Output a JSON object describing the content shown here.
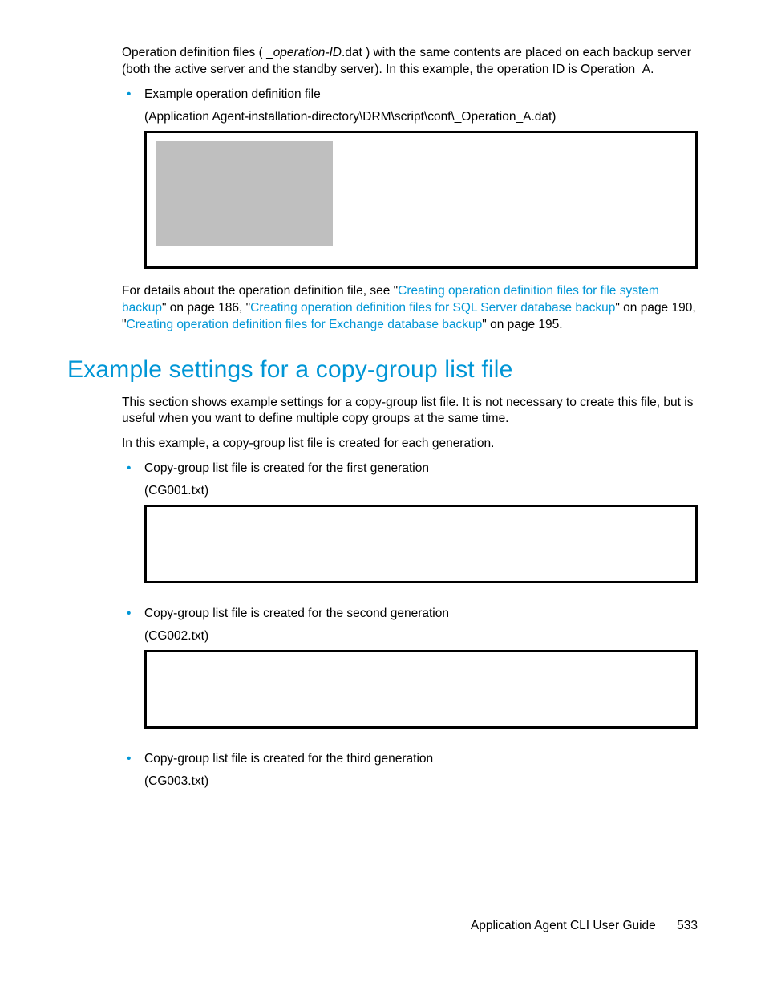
{
  "intro": {
    "before_italic": "Operation definition files ( _",
    "italic": "operation-ID",
    "after_italic": ".dat ) with the same contents are placed on each backup server (both the active server and the standby server). In this example, the operation ID is Operation_A."
  },
  "list1": {
    "item": "Example operation definition file",
    "paren": "(Application Agent-installation-directory\\DRM\\script\\conf\\_Operation_A.dat)"
  },
  "ref": {
    "t1": "For details about the operation definition file, see \"",
    "link1": "Creating operation definition files for file system backup",
    "t2": "\" on page 186, \"",
    "link2": "Creating operation definition files for SQL Server database backup",
    "t3": "\" on page 190, \"",
    "link3": "Creating operation definition files for Exchange database backup",
    "t4": "\" on page 195."
  },
  "heading": "Example settings for a copy-group list file",
  "section_body": {
    "p1": "This section shows example settings for a copy-group list file. It is not necessary to create this file, but is useful when you want to define multiple copy groups at the same time.",
    "p2": "In this example, a copy-group list file is created for each generation."
  },
  "gens": [
    {
      "label": "Copy-group list file is created for the first generation",
      "paren": "(CG001.txt)"
    },
    {
      "label": "Copy-group list file is created for the second generation",
      "paren": "(CG002.txt)"
    },
    {
      "label": "Copy-group list file is created for the third generation",
      "paren": "(CG003.txt)"
    }
  ],
  "footer": {
    "title": "Application Agent CLI User Guide",
    "page": "533"
  }
}
